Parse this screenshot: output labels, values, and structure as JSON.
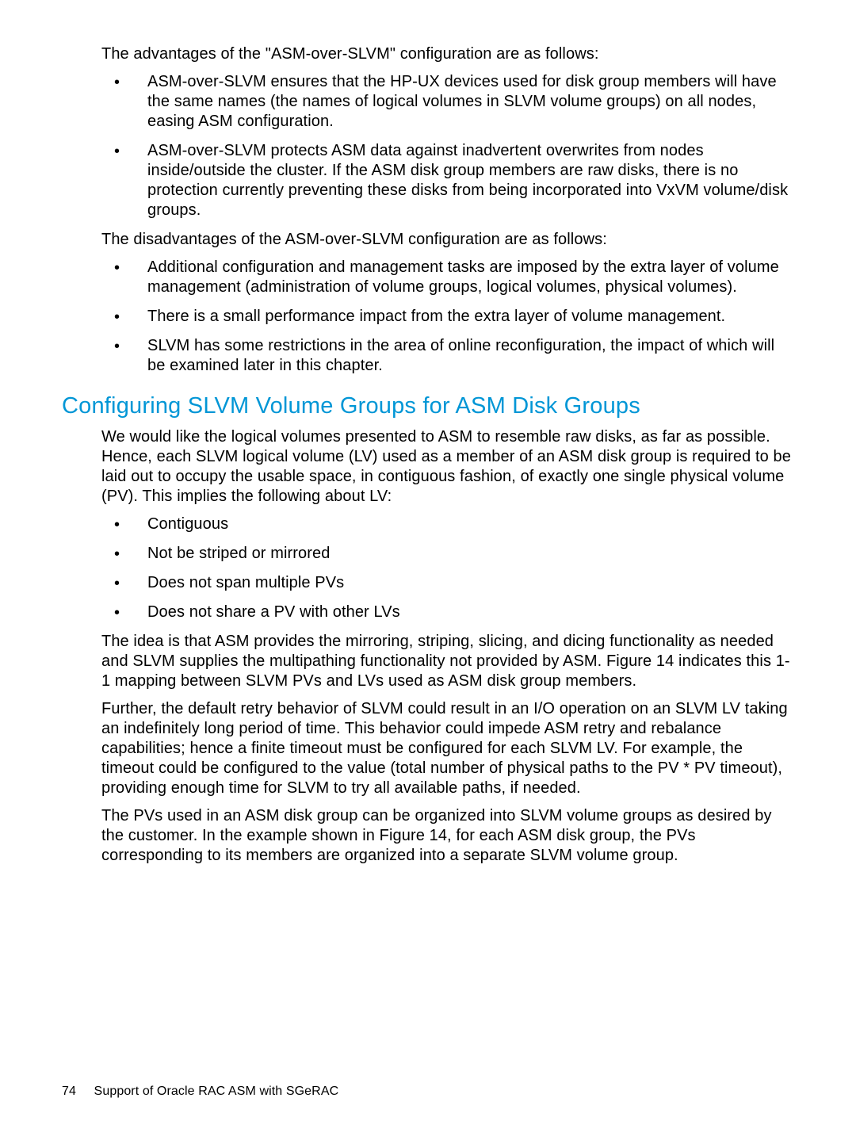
{
  "intro_advantages": "The advantages of the \"ASM-over-SLVM\" configuration are as follows:",
  "adv_list": [
    "ASM-over-SLVM ensures that the HP-UX devices used for disk group members will have the same names (the names of logical volumes in SLVM volume groups) on all nodes, easing ASM configuration.",
    "ASM-over-SLVM protects ASM data against inadvertent overwrites from nodes inside/outside the cluster. If the ASM disk group members are raw disks, there is no protection currently preventing these disks from being incorporated into VxVM volume/disk groups."
  ],
  "intro_disadvantages": "The disadvantages of the ASM-over-SLVM configuration are as follows:",
  "disadv_list": [
    "Additional configuration and management tasks are imposed by the extra layer of volume management (administration of volume groups, logical volumes, physical volumes).",
    "There is a small performance impact from the extra layer of volume management.",
    "SLVM has some restrictions in the area of online reconfiguration, the impact of which will be examined later in this chapter."
  ],
  "heading": "Configuring SLVM Volume Groups for ASM Disk Groups",
  "para_intro2": "We would like the logical volumes presented to ASM to resemble raw disks, as far as possible. Hence, each SLVM logical volume (LV) used as a member of an ASM disk group is required to be laid out to occupy the usable space, in contiguous fashion, of exactly one single physical volume (PV). This implies the following about LV:",
  "lv_list": [
    "Contiguous",
    "Not be striped or mirrored",
    "Does not span multiple PVs",
    "Does not share a PV with other LVs"
  ],
  "para_idea": "The idea is that ASM provides the mirroring, striping, slicing, and dicing functionality as needed and SLVM supplies the multipathing functionality not provided by ASM. Figure 14 indicates this 1-1 mapping between SLVM PVs and LVs used as ASM disk group members.",
  "para_retry": "Further, the default retry behavior of SLVM could result in an I/O operation on an SLVM LV taking an indefinitely long period of time. This behavior could impede ASM retry and rebalance capabilities; hence a finite timeout must be configured for each SLVM LV. For example, the timeout could be configured to the value (total number of physical paths to the PV * PV timeout), providing enough time for SLVM to try all available paths, if needed.",
  "para_pvs": "The PVs used in an ASM disk group can be organized into SLVM volume groups as desired by the customer. In the example shown in Figure 14, for each ASM disk group, the PVs corresponding to its members are organized into a separate SLVM volume group.",
  "footer": {
    "page_number": "74",
    "chapter": "Support of Oracle RAC ASM with SGeRAC"
  }
}
